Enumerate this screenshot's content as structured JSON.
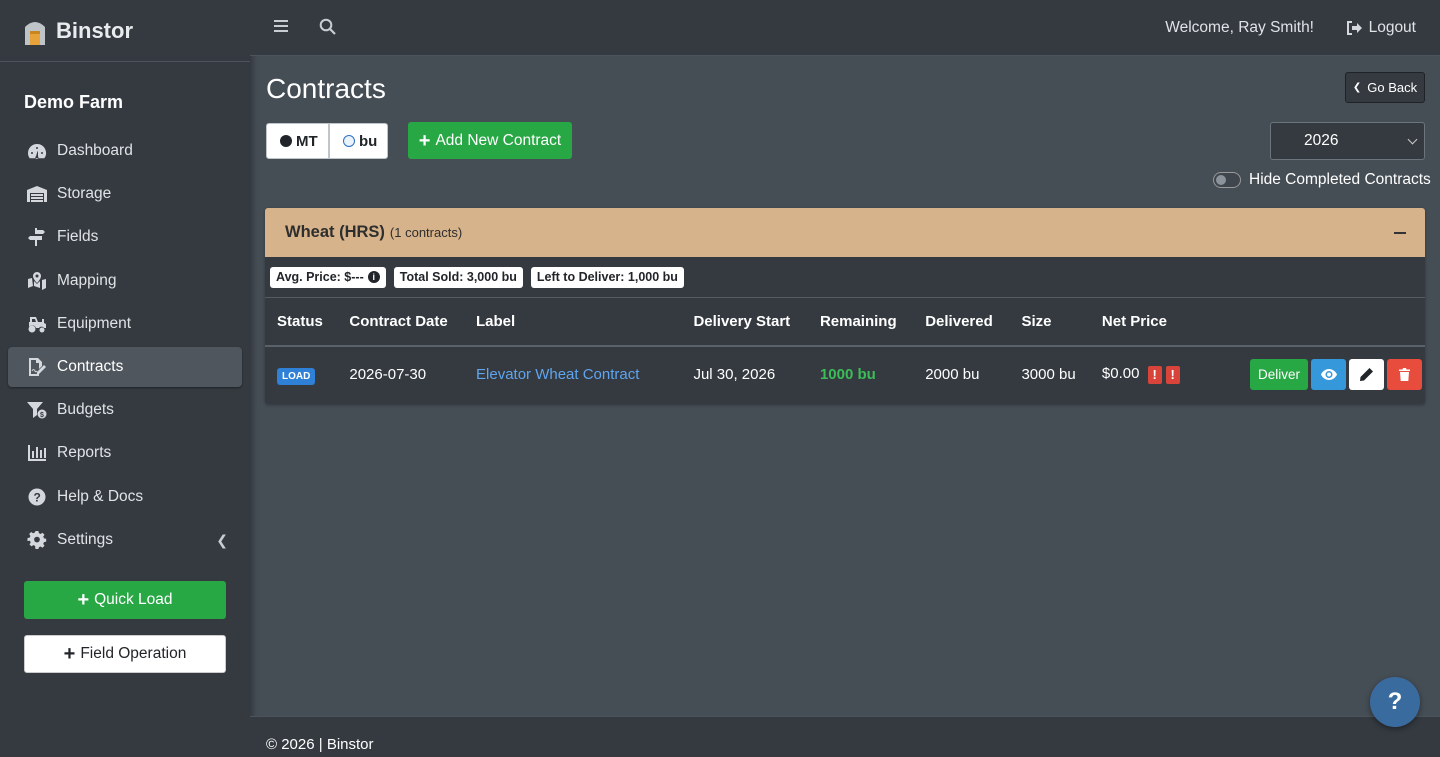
{
  "brand": {
    "name": "Binstor",
    "icon": "silo-icon"
  },
  "farm_name": "Demo Farm",
  "sidebar": {
    "items": [
      {
        "label": "Dashboard",
        "icon": "tachometer-icon",
        "active": false
      },
      {
        "label": "Storage",
        "icon": "warehouse-icon",
        "active": false
      },
      {
        "label": "Fields",
        "icon": "signpost-icon",
        "active": false
      },
      {
        "label": "Mapping",
        "icon": "map-marker-icon",
        "active": false
      },
      {
        "label": "Equipment",
        "icon": "tractor-icon",
        "active": false
      },
      {
        "label": "Contracts",
        "icon": "file-signature-icon",
        "active": true
      },
      {
        "label": "Budgets",
        "icon": "funnel-dollar-icon",
        "active": false
      },
      {
        "label": "Reports",
        "icon": "bar-chart-icon",
        "active": false
      },
      {
        "label": "Help & Docs",
        "icon": "question-circle-icon",
        "active": false
      },
      {
        "label": "Settings",
        "icon": "gear-icon",
        "active": false,
        "has_submenu": true
      }
    ],
    "quick_load": "Quick Load",
    "field_operation": "Field Operation"
  },
  "topbar": {
    "welcome": "Welcome, Ray Smith!",
    "logout": "Logout"
  },
  "page": {
    "title": "Contracts",
    "go_back": "Go Back",
    "units": {
      "mt": "MT",
      "bu": "bu",
      "selected": "bu"
    },
    "add_contract": "Add New Contract",
    "year": "2026",
    "hide_completed": "Hide Completed Contracts",
    "hide_completed_on": false
  },
  "group": {
    "crop": "Wheat (HRS)",
    "count_text": "(1 contracts)",
    "badges": {
      "avg_price": "Avg. Price: $---",
      "total_sold": "Total Sold: 3,000 bu",
      "left_to_deliver": "Left to Deliver: 1,000 bu"
    },
    "columns": [
      "Status",
      "Contract Date",
      "Label",
      "Delivery Start",
      "Remaining",
      "Delivered",
      "Size",
      "Net Price"
    ],
    "rows": [
      {
        "status": "LOAD",
        "contract_date": "2026-07-30",
        "label": "Elevator Wheat Contract",
        "delivery_start": "Jul 30, 2026",
        "remaining": "1000 bu",
        "delivered": "2000 bu",
        "size": "3000 bu",
        "net_price": "$0.00",
        "warning_glyph": "!",
        "deliver_label": "Deliver"
      }
    ]
  },
  "footer": {
    "text": "© 2026 | Binstor"
  },
  "help_fab": "?",
  "colors": {
    "sidebar_bg": "#343a40",
    "content_bg": "#454d55",
    "success": "#28a745",
    "group_header": "#d6b38b",
    "link": "#5fa5ef",
    "danger": "#e74c3c",
    "info": "#3498db"
  }
}
